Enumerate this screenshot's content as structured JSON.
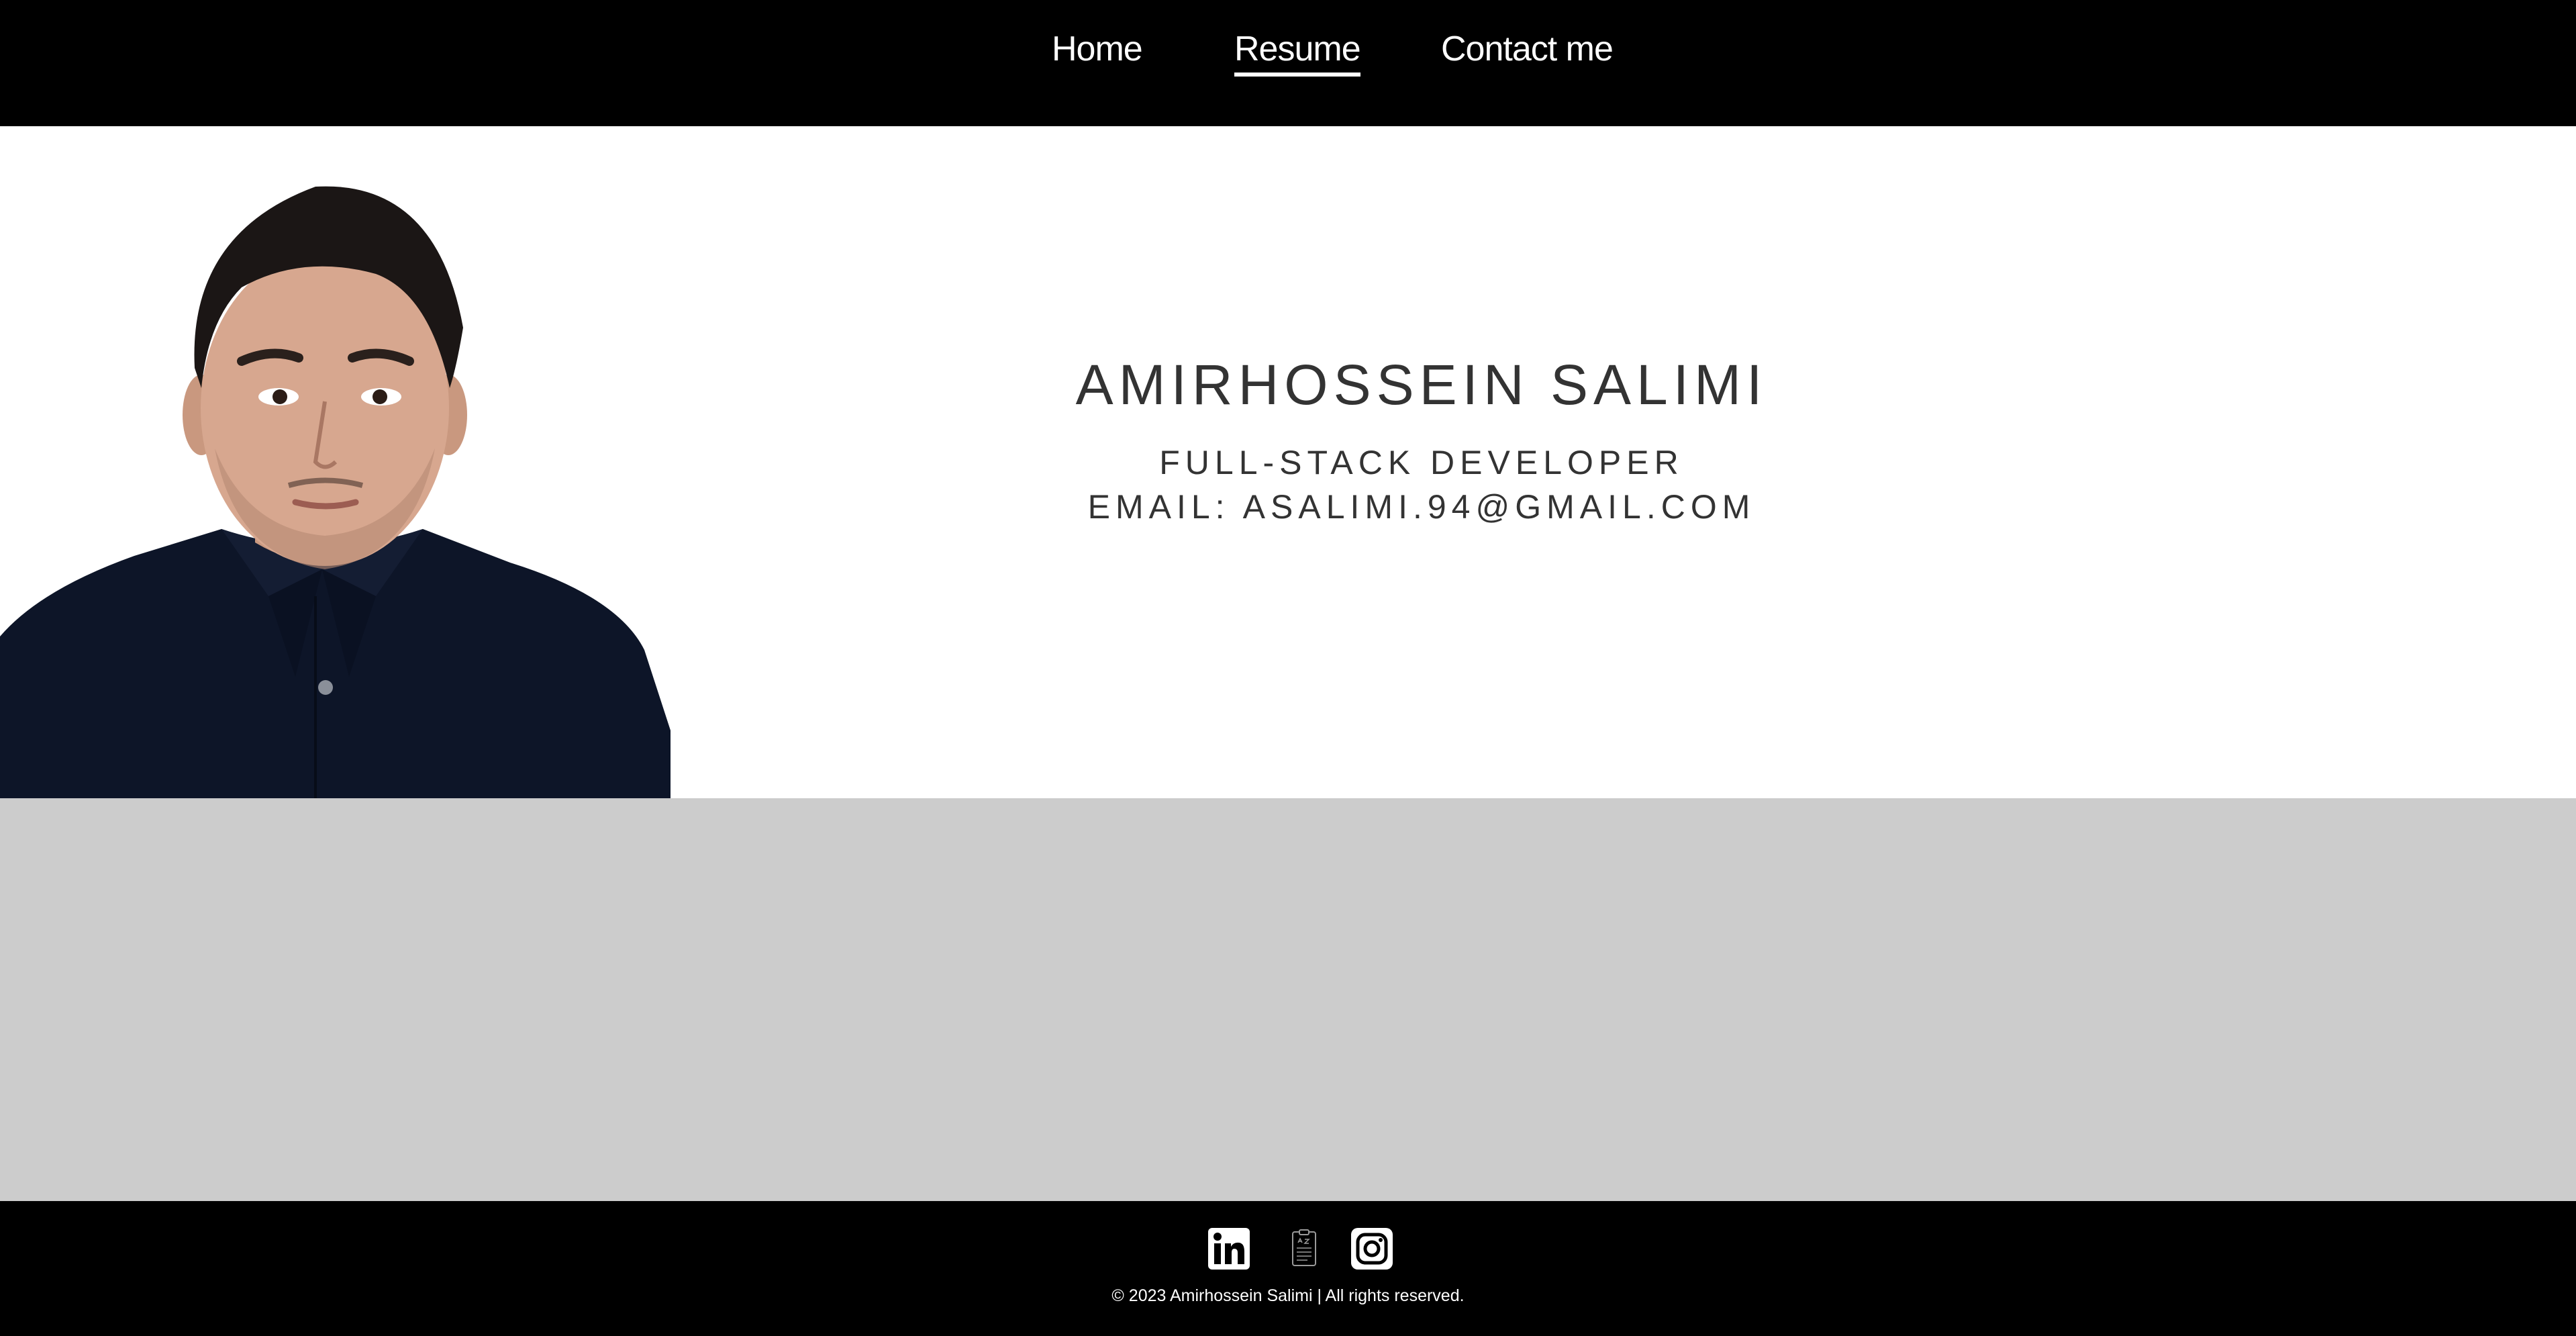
{
  "nav": {
    "items": [
      {
        "label": "Home",
        "active": false
      },
      {
        "label": "Resume",
        "active": true
      },
      {
        "label": "Contact me",
        "active": false
      }
    ]
  },
  "hero": {
    "name": "AMIRHOSSEIN SALIMI",
    "role": "FULL-STACK DEVELOPER",
    "email": "EMAIL: ASALIMI.94@GMAIL.COM",
    "portrait_icon": "profile-photo"
  },
  "footer": {
    "icons": [
      "linkedin-icon",
      "resume-document-icon",
      "instagram-icon"
    ],
    "copyright": "© 2023 Amirhossein Salimi | All rights reserved."
  },
  "colors": {
    "nav_bg": "#000000",
    "nav_text": "#ffffff",
    "hero_bg": "#ffffff",
    "hero_text": "#333333",
    "gray_section": "#cccccc",
    "footer_bg": "#000000",
    "shirt": "#0d1528"
  }
}
